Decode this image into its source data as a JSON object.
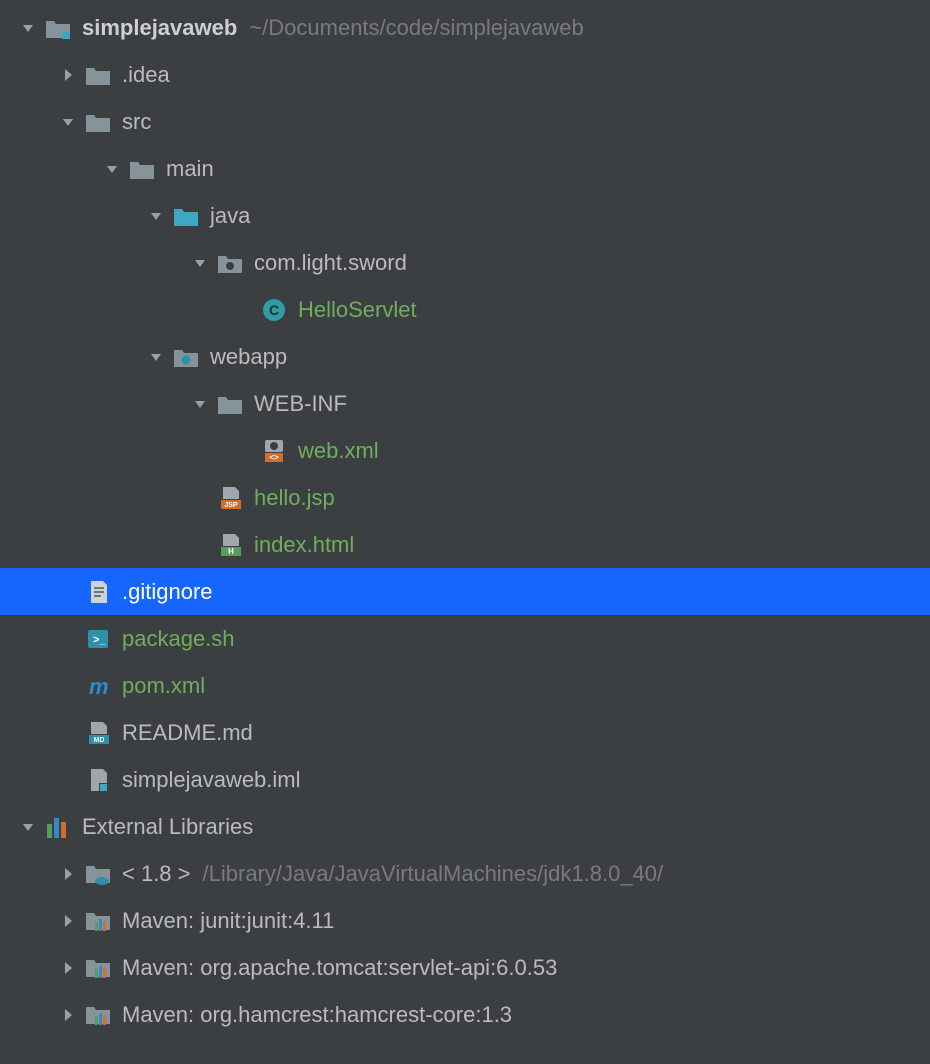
{
  "tree": {
    "root": {
      "name": "simplejavaweb",
      "path": "~/Documents/code/simplejavaweb"
    },
    "idea": ".idea",
    "src": "src",
    "main": "main",
    "java": "java",
    "package": "com.light.sword",
    "helloServlet": "HelloServlet",
    "webapp": "webapp",
    "webinf": "WEB-INF",
    "webxml": "web.xml",
    "hellojsp": "hello.jsp",
    "indexhtml": "index.html",
    "gitignore": ".gitignore",
    "packagesh": "package.sh",
    "pomxml": "pom.xml",
    "readme": "README.md",
    "iml": "simplejavaweb.iml",
    "externalLibs": "External Libraries",
    "jdk": {
      "label": "< 1.8 >",
      "path": "/Library/Java/JavaVirtualMachines/jdk1.8.0_40/"
    },
    "maven1": "Maven: junit:junit:4.11",
    "maven2": "Maven: org.apache.tomcat:servlet-api:6.0.53",
    "maven3": "Maven: org.hamcrest:hamcrest-core:1.3"
  },
  "colors": {
    "arrow": "#9aa0a6",
    "folder": "#87939a",
    "folderBlue": "#3ea7c4",
    "badgeBlue": "#2e91ab",
    "green": "#6fae5d",
    "orange": "#d36e2a",
    "classCircle": "#2d9ea8",
    "mavenM": "#2f8bcf",
    "libBars": [
      "#53a05a",
      "#2f8bcf",
      "#d36e2a"
    ],
    "textFile": "#9ea7ad"
  }
}
